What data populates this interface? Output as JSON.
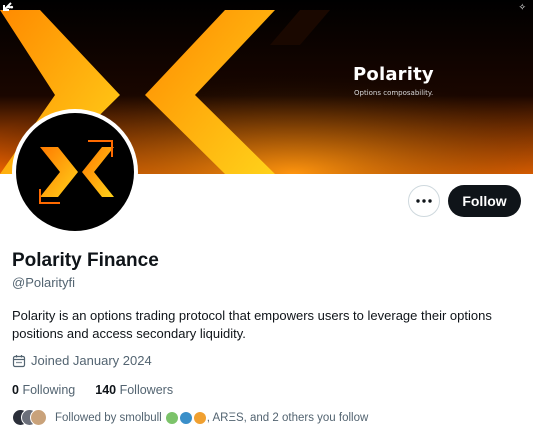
{
  "banner": {
    "title": "Polarity",
    "subtitle": "Options composability.",
    "colors": {
      "orange": "#ff8a00",
      "yellow": "#ffd21a",
      "dark": "#0a0a0a"
    }
  },
  "profile": {
    "display_name": "Polarity Finance",
    "handle": "@Polarityfi",
    "bio": "Polarity is an options trading protocol that empowers users to leverage their options positions and access secondary liquidity.",
    "joined": "Joined January 2024"
  },
  "actions": {
    "more_icon": "more-horizontal-icon",
    "follow_label": "Follow"
  },
  "stats": {
    "following_count": "0",
    "following_label": "Following",
    "followers_count": "140",
    "followers_label": "Followers"
  },
  "followed_by": {
    "prefix": "Followed by smolbull",
    "suffix": ", ARΞS, and 2 others you follow"
  }
}
